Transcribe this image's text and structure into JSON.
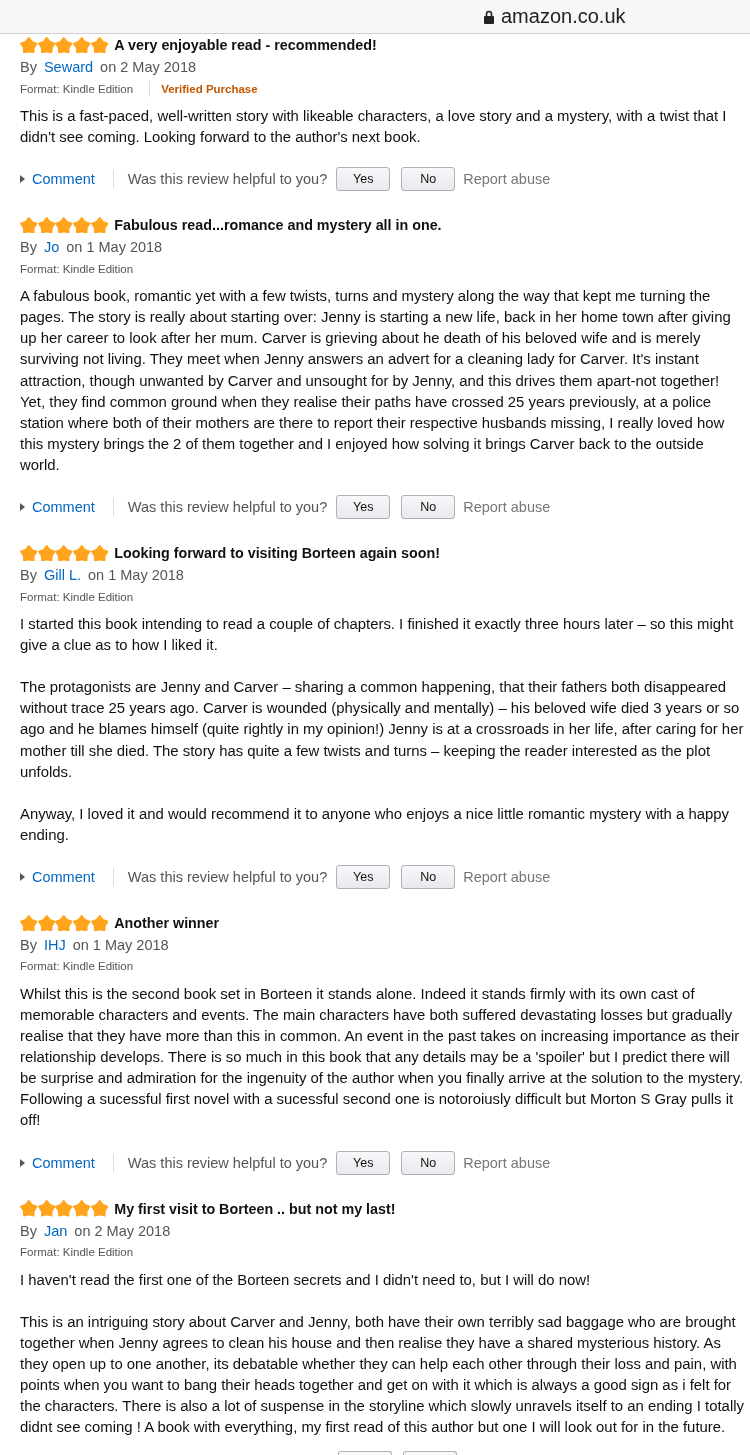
{
  "address_bar": {
    "url": "amazon.co.uk"
  },
  "reviews": [
    {
      "stars": 5,
      "title": "A very enjoyable read - recommended!",
      "by_label": "By",
      "author": "Seward",
      "date": "on 2 May 2018",
      "format": "Format: Kindle Edition",
      "badge": "Verified Purchase",
      "paragraphs": [
        "This is a fast-paced, well-written story with likeable characters, a love story and a mystery, with a twist that I didn't see coming. Looking forward to the author's next book."
      ],
      "cut_off": false,
      "actions": {
        "comment": "Comment",
        "prompt": "Was this review helpful to you?",
        "buttons": [
          "Yes",
          "No"
        ],
        "report": "Report abuse"
      }
    },
    {
      "stars": 5,
      "title": "Fabulous read...romance and mystery all in one.",
      "by_label": "By",
      "author": "Jo",
      "date": "on 1 May 2018",
      "format": "Format: Kindle Edition",
      "paragraphs": [
        "A fabulous book, romantic yet with a few twists, turns and mystery along the way that kept me turning the pages. The story is really about starting over: Jenny is starting a new life, back in her home town after giving up her career to look after her mum. Carver is grieving about he death of his beloved wife and is merely surviving not living. They meet when Jenny answers an advert for a cleaning lady for Carver. It's instant attraction, though unwanted by Carver and unsought for by Jenny, and this drives them apart-not together! Yet, they find common ground when they realise their paths have crossed 25 years previously, at a police station where both of their mothers are there to report their respective husbands missing, I really loved how this mystery brings the 2 of them together and I enjoyed how solving it brings Carver back to the outside world."
      ],
      "cut_off": false,
      "actions": {
        "comment": "Comment",
        "prompt": "Was this review helpful to you?",
        "buttons": [
          "Yes",
          "No"
        ],
        "report": "Report abuse"
      }
    },
    {
      "stars": 5,
      "title": "Looking forward to visiting Borteen again soon!",
      "by_label": "By",
      "author": "Gill L.",
      "date": "on 1 May 2018",
      "format": "Format: Kindle Edition",
      "paragraphs": [
        "I started this book intending to read a couple of chapters. I finished it exactly three hours later – so this might give a clue as to how I liked it.",
        "The protagonists are Jenny and Carver – sharing a common happening, that their fathers both disappeared without trace 25 years ago. Carver is wounded (physically and mentally) – his beloved wife died 3 years or so ago and he blames himself (quite rightly in my opinion!) Jenny is at a crossroads in her life, after caring for her mother till she died. The story has quite a few twists and turns – keeping the reader interested as the plot unfolds.",
        "Anyway, I loved it and would recommend it to anyone who enjoys a nice little romantic mystery with a happy ending."
      ],
      "cut_off": false,
      "actions": {
        "comment": "Comment",
        "prompt": "Was this review helpful to you?",
        "buttons": [
          "Yes",
          "No"
        ],
        "report": "Report abuse"
      }
    },
    {
      "stars": 5,
      "title": "Another winner",
      "by_label": "By",
      "author": "IHJ",
      "date": "on 1 May 2018",
      "format": "Format: Kindle Edition",
      "paragraphs": [
        "Whilst this is the second book set in Borteen it stands alone. Indeed it stands firmly with its own cast of memorable characters and events. The main characters have both suffered devastating losses but gradually realise that they have more than this in common. An event in the past takes on increasing importance as their relationship develops. There is so much in this book that any details may be a 'spoiler' but I predict there will be surprise and admiration for the ingenuity of the author when you finally arrive at the solution to the mystery. Following a sucessful first novel with a sucessful second one is notoroiusly difficult but Morton S Gray pulls it off!"
      ],
      "cut_off": false,
      "actions": {
        "comment": "Comment",
        "prompt": "Was this review helpful to you?",
        "buttons": [
          "Yes",
          "No"
        ],
        "report": "Report abuse"
      }
    },
    {
      "stars": 5,
      "title": "My first visit to Borteen .. but not my last!",
      "by_label": "By",
      "author": "Jan",
      "date": "on 2 May 2018",
      "format": "Format: Kindle Edition",
      "paragraphs": [
        "I haven't read the first one of the Borteen secrets and I didn't need to, but I will do now!",
        "This is an intriguing story about Carver and Jenny, both have their own terribly sad baggage who are brought together when Jenny agrees to clean his house and then realise they have a shared mysterious history. As they open up to one another, its debatable whether they can help each other through their loss and pain, with points when you want to bang their heads together and get on with it which is always a good sign as i felt for the characters. There is also a lot of suspense in the storyline which slowly unravels itself to an ending I totally didnt see coming ! A book with everything, my first read of this author but one I will look out for in the future."
      ],
      "cut_off": true
    }
  ]
}
